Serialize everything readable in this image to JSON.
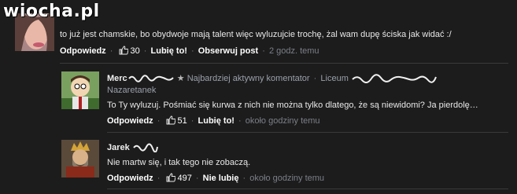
{
  "watermark": "wiocha.pl",
  "comments": [
    {
      "text": "to już jest chamskie, bo obydwoje mają talent więc wyluzujcie trochę, żal wam dupę ściska jak widać :/",
      "reply_label": "Odpowiedz",
      "like_count": "30",
      "like_label": "Lubię to!",
      "follow_label": "Obserwuj post",
      "time": "2 godz. temu"
    },
    {
      "name": "Merc",
      "badge": "Najbardziej aktywny komentator",
      "school": "Liceum",
      "location": "Nazaretanek",
      "text": "To Ty wyluzuj. Pośmiać się kurwa z nich nie można tylko dlatego, że są niewidomi? Ja pierdolę…",
      "reply_label": "Odpowiedz",
      "like_count": "51",
      "like_label": "Lubię to!",
      "time": "około godziny temu"
    },
    {
      "name": "Jarek",
      "text": "Nie martw się, i tak tego nie zobaczą.",
      "reply_label": "Odpowiedz",
      "like_count": "497",
      "like_label": "Nie lubię",
      "time": "około godziny temu"
    }
  ]
}
